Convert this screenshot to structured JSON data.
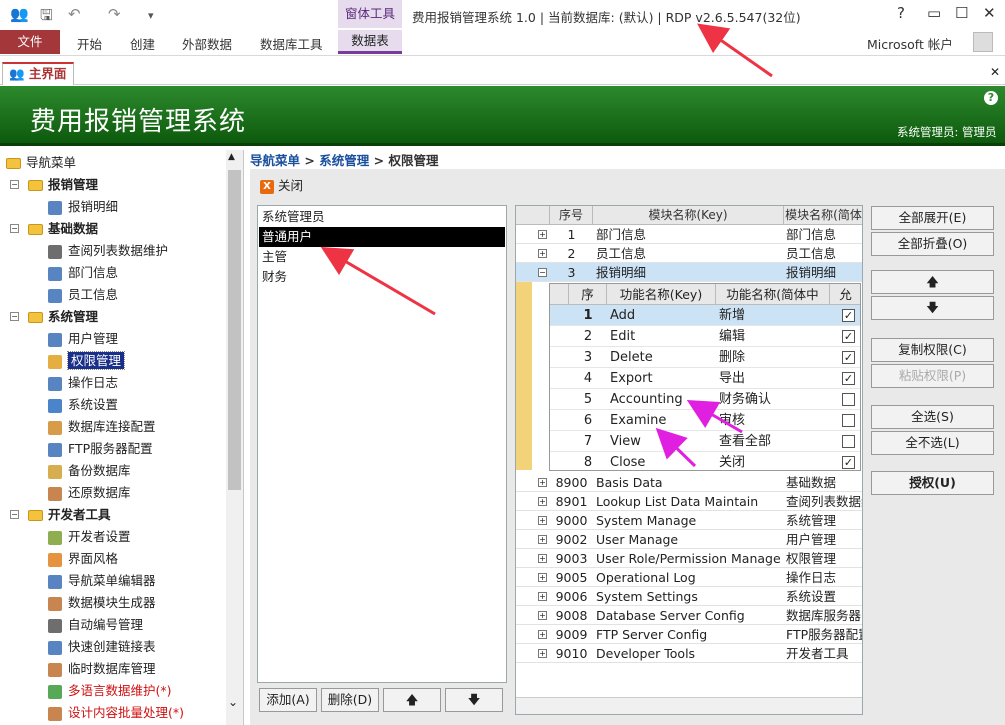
{
  "window": {
    "context_group": "窗体工具",
    "title": "费用报销管理系统 1.0 | 当前数据库: (默认) | RDP v2.6.5.547(32位)",
    "help": "?",
    "account": "Microsoft 帐户"
  },
  "ribbon": {
    "file": "文件",
    "tabs": [
      "开始",
      "创建",
      "外部数据",
      "数据库工具"
    ],
    "context_tab": "数据表"
  },
  "doc_tab": "主界面",
  "banner": {
    "title": "费用报销管理系统",
    "user": "系统管理员: 管理员"
  },
  "nav": {
    "root": "导航菜单",
    "items": [
      {
        "label": "报销管理",
        "level": 1,
        "type": "folder"
      },
      {
        "label": "报销明细",
        "level": 2,
        "type": "leaf",
        "color": "#3b6fb6"
      },
      {
        "label": "基础数据",
        "level": 1,
        "type": "folder"
      },
      {
        "label": "查阅列表数据维护",
        "level": 2,
        "type": "leaf",
        "color": "#555555"
      },
      {
        "label": "部门信息",
        "level": 2,
        "type": "leaf",
        "color": "#3b6fb6"
      },
      {
        "label": "员工信息",
        "level": 2,
        "type": "leaf",
        "color": "#3b6fb6"
      },
      {
        "label": "系统管理",
        "level": 1,
        "type": "folder"
      },
      {
        "label": "用户管理",
        "level": 2,
        "type": "leaf",
        "color": "#3b6fb6"
      },
      {
        "label": "权限管理",
        "level": 2,
        "type": "leaf",
        "color": "#e0a020",
        "selected": true
      },
      {
        "label": "操作日志",
        "level": 2,
        "type": "leaf",
        "color": "#3b6fb6"
      },
      {
        "label": "系统设置",
        "level": 2,
        "type": "leaf",
        "color": "#2a6fc0"
      },
      {
        "label": "数据库连接配置",
        "level": 2,
        "type": "leaf",
        "color": "#d08a2a"
      },
      {
        "label": "FTP服务器配置",
        "level": 2,
        "type": "leaf",
        "color": "#3b6fb6"
      },
      {
        "label": "备份数据库",
        "level": 2,
        "type": "leaf",
        "color": "#d0a030"
      },
      {
        "label": "还原数据库",
        "level": 2,
        "type": "leaf",
        "color": "#c07030"
      },
      {
        "label": "开发者工具",
        "level": 1,
        "type": "folder"
      },
      {
        "label": "开发者设置",
        "level": 2,
        "type": "leaf",
        "color": "#7aa030"
      },
      {
        "label": "界面风格",
        "level": 2,
        "type": "leaf",
        "color": "#e08020"
      },
      {
        "label": "导航菜单编辑器",
        "level": 2,
        "type": "leaf",
        "color": "#3b6fb6"
      },
      {
        "label": "数据模块生成器",
        "level": 2,
        "type": "leaf",
        "color": "#c07030"
      },
      {
        "label": "自动编号管理",
        "level": 2,
        "type": "leaf",
        "color": "#555555"
      },
      {
        "label": "快速创建链接表",
        "level": 2,
        "type": "leaf",
        "color": "#3b6fb6"
      },
      {
        "label": "临时数据库管理",
        "level": 2,
        "type": "leaf",
        "color": "#c07030"
      },
      {
        "label": "多语言数据维护(*)",
        "level": 2,
        "type": "leaf",
        "color": "#3a9a3a",
        "red": true
      },
      {
        "label": "设计内容批量处理(*)",
        "level": 2,
        "type": "leaf",
        "color": "#c07030",
        "red": true
      }
    ]
  },
  "breadcrumb": [
    "导航菜单",
    "系统管理",
    "权限管理"
  ],
  "breadcrumb_sep": ">",
  "close_label": "关闭",
  "close_icon_glyph": "X",
  "roles": [
    "系统管理员",
    "普通用户",
    "主管",
    "财务"
  ],
  "roles_selected": 1,
  "left_buttons": {
    "add": "添加(A)",
    "delete": "删除(D)",
    "up": "🡅",
    "down": "🡇"
  },
  "grid": {
    "headers": [
      "序号",
      "模块名称(Key)",
      "模块名称(简体"
    ],
    "rows_top": [
      {
        "no": "1",
        "key": "部门信息",
        "name": "部门信息",
        "sign": "+"
      },
      {
        "no": "2",
        "key": "员工信息",
        "name": "员工信息",
        "sign": "+"
      },
      {
        "no": "3",
        "key": "报销明细",
        "name": "报销明细",
        "sign": "−",
        "selected": true
      }
    ],
    "sub_headers": [
      "序",
      "功能名称(Key)",
      "功能名称(简体中",
      "允"
    ],
    "sub_rows": [
      {
        "no": "1",
        "key": "Add",
        "name": "新增",
        "checked": true,
        "selected": true
      },
      {
        "no": "2",
        "key": "Edit",
        "name": "编辑",
        "checked": true
      },
      {
        "no": "3",
        "key": "Delete",
        "name": "删除",
        "checked": true
      },
      {
        "no": "4",
        "key": "Export",
        "name": "导出",
        "checked": true
      },
      {
        "no": "5",
        "key": "Accounting",
        "name": "财务确认",
        "checked": false
      },
      {
        "no": "6",
        "key": "Examine",
        "name": "审核",
        "checked": false
      },
      {
        "no": "7",
        "key": "View",
        "name": "查看全部",
        "checked": false
      },
      {
        "no": "8",
        "key": "Close",
        "name": "关闭",
        "checked": true
      }
    ],
    "rows_bottom": [
      {
        "no": "8900",
        "key": "Basis Data",
        "name": "基础数据"
      },
      {
        "no": "8901",
        "key": "Lookup List Data Maintain",
        "name": "查阅列表数据维"
      },
      {
        "no": "9000",
        "key": "System Manage",
        "name": "系统管理"
      },
      {
        "no": "9002",
        "key": "User Manage",
        "name": "用户管理"
      },
      {
        "no": "9003",
        "key": "User Role/Permission Manage",
        "name": "权限管理"
      },
      {
        "no": "9005",
        "key": "Operational Log",
        "name": "操作日志"
      },
      {
        "no": "9006",
        "key": "System Settings",
        "name": "系统设置"
      },
      {
        "no": "9008",
        "key": "Database Server Config",
        "name": "数据库服务器"
      },
      {
        "no": "9009",
        "key": "FTP Server Config",
        "name": "FTP服务器配置"
      },
      {
        "no": "9010",
        "key": "Developer Tools",
        "name": "开发者工具"
      }
    ]
  },
  "right_buttons": {
    "expand_all": "全部展开(E)",
    "collapse_all": "全部折叠(O)",
    "up": "🡅",
    "down": "🡇",
    "copy_perm": "复制权限(C)",
    "paste_perm": "粘贴权限(P)",
    "select_all": "全选(S)",
    "select_none": "全不选(L)",
    "grant": "授权(U)"
  },
  "colors": {
    "accent_green": "#1f7a1f",
    "file_tab": "#a4373a",
    "annotation_arrow": "#ee3344",
    "annotation_magenta": "#e020e0"
  }
}
